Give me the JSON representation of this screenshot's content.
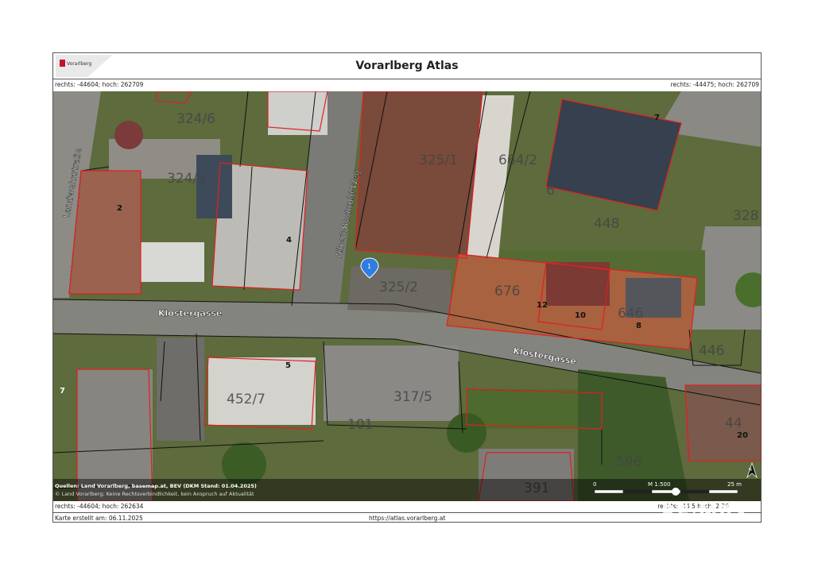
{
  "header": {
    "title": "Vorarlberg Atlas",
    "logo_text": "Vorarlberg",
    "coord_top_left": "rechts: -44604; hoch: 262709",
    "coord_top_right": "rechts: -44475; hoch: 262709",
    "coord_bottom_left": "rechts: -44604; hoch: 262634",
    "coord_bottom_right": "rechts: -44 5 hoch: 2 26"
  },
  "map": {
    "streets": [
      "Landwehrstraße",
      "Albert-Bechtold-Weg",
      "Klostergasse",
      "Klostergasse"
    ],
    "parcels": [
      "324/6",
      "324/5",
      "325/1",
      "664/2",
      "448",
      "328",
      "325/2",
      "676",
      "646",
      "446",
      "452/7",
      "317/5",
      "101",
      "44",
      "596",
      "391",
      "6"
    ],
    "house_numbers": [
      "7",
      "2",
      "4",
      "12",
      "10",
      "8",
      "5",
      "7",
      "20"
    ],
    "marker_label": "1",
    "source_line_1": "Quellen: Land Vorarlberg, basemap.at, BEV (DKM Stand: 01.04.2025)",
    "source_line_2": "© Land Vorarlberg; Keine Rechtsverbindlichkeit, kein Anspruch auf Aktualität",
    "scale": {
      "start": "0",
      "end": "25 m",
      "ratio": "M 1:500"
    },
    "north_label": "N"
  },
  "footer": {
    "created": "Karte erstellt am: 06.11.2025",
    "url": "https://atlas.vorarlberg.at"
  },
  "watermark": "RE/MAX"
}
